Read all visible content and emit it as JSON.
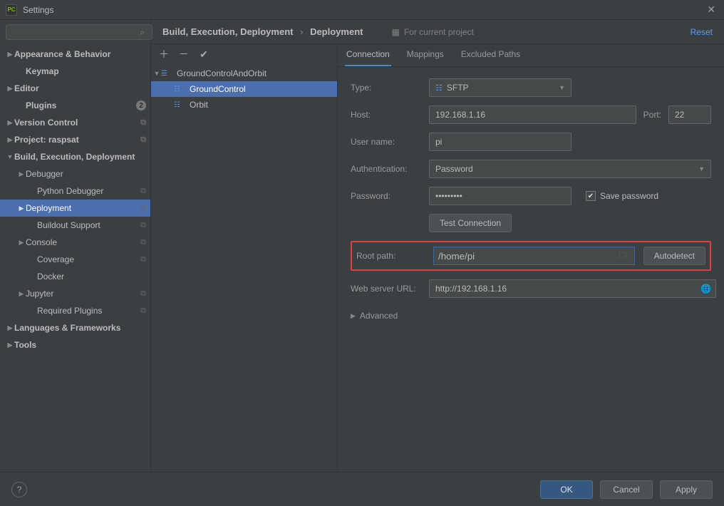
{
  "window": {
    "title": "Settings"
  },
  "search": {
    "placeholder": ""
  },
  "sidebar": {
    "items": [
      {
        "label": "Appearance & Behavior",
        "indent": 8,
        "arrow": "▶",
        "bold": true
      },
      {
        "label": "Keymap",
        "indent": 24,
        "arrow": "",
        "bold": true
      },
      {
        "label": "Editor",
        "indent": 8,
        "arrow": "▶",
        "bold": true
      },
      {
        "label": "Plugins",
        "indent": 24,
        "arrow": "",
        "bold": true,
        "badge": "2"
      },
      {
        "label": "Version Control",
        "indent": 8,
        "arrow": "▶",
        "bold": true,
        "copy": true
      },
      {
        "label": "Project: raspsat",
        "indent": 8,
        "arrow": "▶",
        "bold": true,
        "copy": true
      },
      {
        "label": "Build, Execution, Deployment",
        "indent": 8,
        "arrow": "▼",
        "bold": true
      },
      {
        "label": "Debugger",
        "indent": 24,
        "arrow": "▶"
      },
      {
        "label": "Python Debugger",
        "indent": 40,
        "arrow": "",
        "copy": true
      },
      {
        "label": "Deployment",
        "indent": 24,
        "arrow": "▶",
        "selected": true,
        "copy": true
      },
      {
        "label": "Buildout Support",
        "indent": 40,
        "arrow": "",
        "copy": true
      },
      {
        "label": "Console",
        "indent": 24,
        "arrow": "▶",
        "copy": true
      },
      {
        "label": "Coverage",
        "indent": 40,
        "arrow": "",
        "copy": true
      },
      {
        "label": "Docker",
        "indent": 40,
        "arrow": ""
      },
      {
        "label": "Jupyter",
        "indent": 24,
        "arrow": "▶",
        "copy": true
      },
      {
        "label": "Required Plugins",
        "indent": 40,
        "arrow": "",
        "copy": true
      },
      {
        "label": "Languages & Frameworks",
        "indent": 8,
        "arrow": "▶",
        "bold": true
      },
      {
        "label": "Tools",
        "indent": 8,
        "arrow": "▶",
        "bold": true
      }
    ]
  },
  "breadcrumb": {
    "segments": [
      "Build, Execution, Deployment",
      "Deployment"
    ]
  },
  "context_label": "For current project",
  "reset_label": "Reset",
  "tree": {
    "root": {
      "label": "GroundControlAndOrbit"
    },
    "children": [
      {
        "label": "GroundControl",
        "selected": true
      },
      {
        "label": "Orbit"
      }
    ]
  },
  "tabs": [
    {
      "label": "Connection",
      "active": true
    },
    {
      "label": "Mappings"
    },
    {
      "label": "Excluded Paths"
    }
  ],
  "form": {
    "type_label": "Type:",
    "type_value": "SFTP",
    "host_label": "Host:",
    "host_value": "192.168.1.16",
    "port_label": "Port:",
    "port_value": "22",
    "user_label": "User name:",
    "user_value": "pi",
    "auth_label": "Authentication:",
    "auth_value": "Password",
    "password_label": "Password:",
    "password_value": "•••••••••",
    "save_password_label": "Save password",
    "save_password_checked": true,
    "test_connection_label": "Test Connection",
    "root_label": "Root path:",
    "root_value": "/home/pi",
    "autodetect_label": "Autodetect",
    "web_label": "Web server URL:",
    "web_value": "http://192.168.1.16",
    "advanced_label": "Advanced"
  },
  "footer": {
    "ok": "OK",
    "cancel": "Cancel",
    "apply": "Apply"
  }
}
